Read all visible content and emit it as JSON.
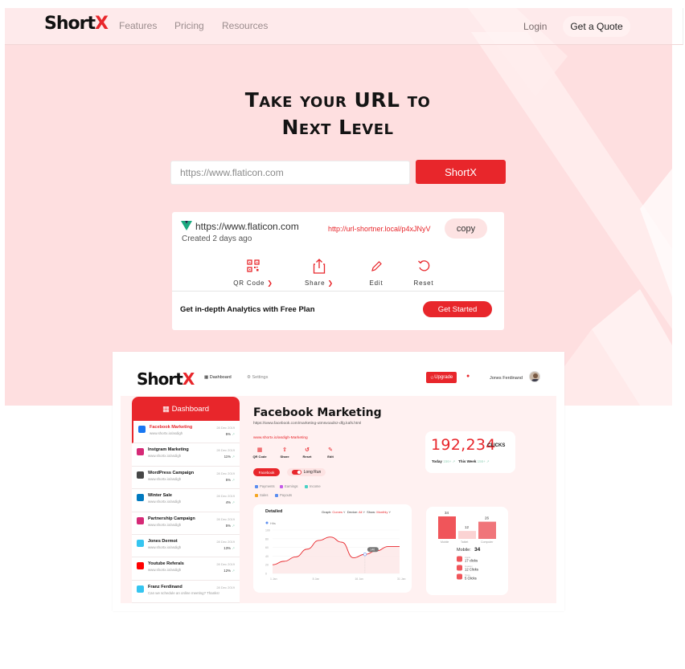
{
  "brand": {
    "logo_main": "Short",
    "logo_x": "X",
    "accent": "#e8262b",
    "hero_bg": "#fedfe0"
  },
  "nav": {
    "features": "Features",
    "pricing": "Pricing",
    "resources": "Resources",
    "login": "Login",
    "quote": "Get a Quote"
  },
  "hero": {
    "title_line1": "Take your URL to",
    "title_line2": "Next Level",
    "input_placeholder": "https://www.flaticon.com",
    "submit": "ShortX"
  },
  "result": {
    "long_url": "https://www.flaticon.com",
    "created": "Created 2 days ago",
    "short_url": "http://url-shortner.local/p4xJNyV",
    "copy": "copy",
    "actions": [
      {
        "label": "QR Code",
        "icon": "qr-code-icon",
        "has_chevron": true
      },
      {
        "label": "Share",
        "icon": "share-icon",
        "has_chevron": true
      },
      {
        "label": "Edit",
        "icon": "edit-icon",
        "has_chevron": false
      },
      {
        "label": "Reset",
        "icon": "reset-icon",
        "has_chevron": false
      }
    ],
    "analytics_text": "Get in-depth Analytics with Free Plan",
    "get_started": "Get Started"
  },
  "dashboard": {
    "logo_main": "Short",
    "logo_x": "X",
    "tab_dashboard": "Dashboard",
    "tab_settings": "Settings",
    "upgrade": "Upgrade",
    "user_name": "Jones Ferdinand",
    "sidebar_title": "Dashboard",
    "sidebar_items": [
      {
        "title": "Facebook Marketing",
        "sub": "www.shortx.io/asdigh",
        "date": "28 Dec 2019",
        "pct": "5%",
        "color": "#1877f2",
        "active": true
      },
      {
        "title": "Instgram Marketing",
        "sub": "www.shortx.io/asdigh",
        "date": "28 Dec 2019",
        "pct": "11%",
        "color": "#d62976",
        "active": false
      },
      {
        "title": "WordPress Campaign",
        "sub": "www.shortx.io/asdigh",
        "date": "28 Dec 2019",
        "pct": "5%",
        "color": "#464646",
        "active": false
      },
      {
        "title": "Winter Sale",
        "sub": "www.shortx.io/asdigh",
        "date": "28 Dec 2019",
        "pct": "4%",
        "color": "#0079bf",
        "active": false
      },
      {
        "title": "Partnership Campaign",
        "sub": "www.shortx.io/asdigh",
        "date": "28 Dec 2019",
        "pct": "5%",
        "color": "#d62976",
        "active": false
      },
      {
        "title": "Jones Dermot",
        "sub": "www.shortx.io/asdigh",
        "date": "28 Dec 2019",
        "pct": "13%",
        "color": "#36c5f0",
        "active": false
      },
      {
        "title": "Youtube Referals",
        "sub": "www.shortx.io/asdigh",
        "date": "28 Dec 2019",
        "pct": "12%",
        "color": "#ff0000",
        "active": false
      },
      {
        "title": "Franz Ferdinand",
        "sub": "Can we schedule an online meeting? Thanks!",
        "date": "28 Dec 2019",
        "pct": "",
        "color": "#36c5f0",
        "active": false
      }
    ],
    "main_title": "Facebook Marketing",
    "main_url": "https://www.facebook.com/marketing-utmsvoadnz-dfg.kafs.html",
    "main_short": "www.shortx.io/asdigh-Marketing",
    "main_actions": [
      "QR Code",
      "Share",
      "Reset",
      "Edit"
    ],
    "pill_facebook": "Facebook",
    "pill_long_run": "Long Run",
    "legend": [
      {
        "label": "Payments",
        "color": "#5b8def"
      },
      {
        "label": "Earnings",
        "color": "#c45ae8"
      },
      {
        "label": "Income",
        "color": "#49d1c5"
      },
      {
        "label": "Sales",
        "color": "#f5a623"
      },
      {
        "label": "Payouts",
        "color": "#5b8def"
      }
    ],
    "clicks_value": "192,234",
    "clicks_label": "CLICKS",
    "today_label": "Today",
    "today_value": "156+",
    "week_label": "This Week",
    "week_value": "156+",
    "chart_title": "Detailed",
    "chart_options": {
      "graph_label": "Graph:",
      "graph_value": "Curves",
      "device_label": "Device:",
      "device_value": "All",
      "show_label": "Show:",
      "show_value": "Monthly"
    },
    "chart_series_name": "Hits",
    "chart_y_ticks": [
      "100",
      "80",
      "60",
      "40",
      "20",
      "0"
    ],
    "chart_x_ticks": [
      "1 Jan",
      "8 Jan",
      "16 Jan",
      "31 Jan"
    ],
    "chart_tooltip": "140",
    "chart_values": [
      20,
      28,
      38,
      56,
      76,
      84,
      72,
      36,
      44,
      52,
      62,
      62
    ],
    "devices": [
      {
        "label": "Mobile",
        "value": 34,
        "color": "#f0555a"
      },
      {
        "label": "Tablet",
        "value": 12,
        "color": "#fbd3d3"
      },
      {
        "label": "Computer",
        "value": 26,
        "color": "#f0757a"
      }
    ],
    "mobile_summary_label": "Mobile:",
    "mobile_summary_value": "34",
    "device_clicks": [
      {
        "name": "Apple",
        "clicks": "17 clicks"
      },
      {
        "name": "Huawei",
        "clicks": "12 Clicks"
      },
      {
        "name": "Oppo",
        "clicks": "5 Clicks"
      }
    ]
  }
}
